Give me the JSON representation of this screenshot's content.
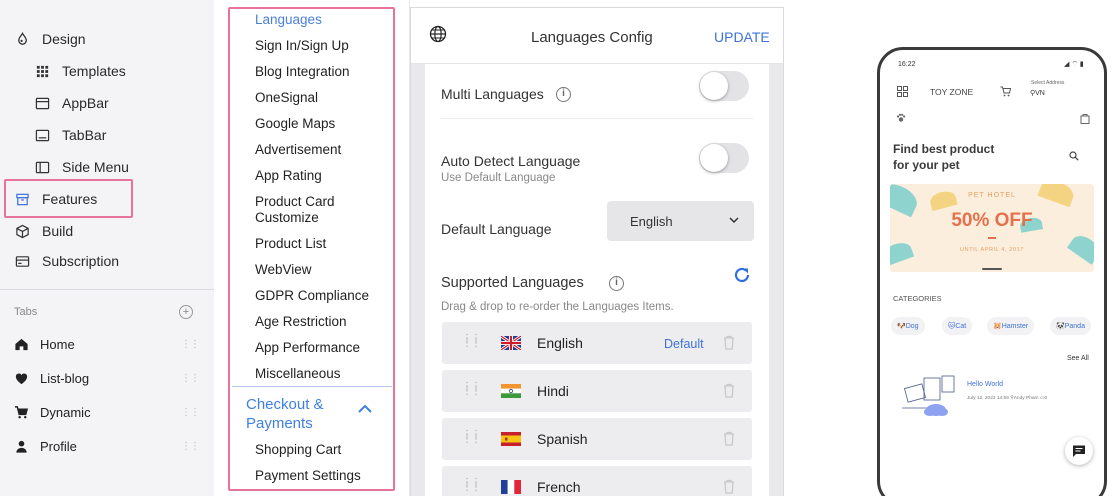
{
  "left_nav": {
    "items": [
      {
        "label": "Design",
        "icon": "palette-icon"
      },
      {
        "label": "Templates",
        "icon": "grid-icon"
      },
      {
        "label": "AppBar",
        "icon": "appbar-icon"
      },
      {
        "label": "TabBar",
        "icon": "tabbar-icon"
      },
      {
        "label": "Side Menu",
        "icon": "side-menu-icon"
      },
      {
        "label": "Features",
        "icon": "archive-icon"
      },
      {
        "label": "Build",
        "icon": "cube-icon"
      },
      {
        "label": "Subscription",
        "icon": "card-icon"
      }
    ],
    "tabs_label": "Tabs",
    "tabs": [
      {
        "label": "Home",
        "icon": "home-icon"
      },
      {
        "label": "List-blog",
        "icon": "heart-icon"
      },
      {
        "label": "Dynamic",
        "icon": "cart-icon"
      },
      {
        "label": "Profile",
        "icon": "person-icon"
      }
    ],
    "highlight_color": "#e8739a"
  },
  "feature_list": {
    "items": [
      "Languages",
      "Sign In/Sign Up",
      "Blog Integration",
      "OneSignal",
      "Google Maps",
      "Advertisement",
      "App Rating",
      "Product Card Customize",
      "Product List",
      "WebView",
      "GDPR Compliance",
      "Age Restriction",
      "App Performance",
      "Miscellaneous"
    ],
    "active": "Languages",
    "section_title": "Checkout & Payments",
    "section_items": [
      "Shopping Cart",
      "Payment Settings"
    ],
    "accent_color": "#3f7fe0"
  },
  "config": {
    "title": "Languages Config",
    "update_label": "UPDATE",
    "multi_languages_label": "Multi Languages",
    "multi_languages_enabled": false,
    "auto_detect_label": "Auto Detect Language",
    "auto_detect_sub": "Use Default Language",
    "auto_detect_enabled": false,
    "default_language_label": "Default Language",
    "default_language_value": "English",
    "supported_label": "Supported Languages",
    "supported_hint": "Drag & drop to re-order the Languages Items.",
    "languages": [
      {
        "name": "English",
        "flag": "uk-flag",
        "badge": "Default"
      },
      {
        "name": "Hindi",
        "flag": "india-flag",
        "badge": ""
      },
      {
        "name": "Spanish",
        "flag": "spain-flag",
        "badge": ""
      },
      {
        "name": "French",
        "flag": "france-flag",
        "badge": ""
      }
    ]
  },
  "phone": {
    "time": "16:22",
    "brand": "TOY ZONE",
    "address_label": "Select Address",
    "address_value": "VN",
    "headline_1": "Find best product",
    "headline_2": "for your pet",
    "banner_pre": "PET HOTEL",
    "banner_main": "50% OFF",
    "banner_sub": "UNTIL APRIL 4, 2017",
    "categories_label": "CATEGORIES",
    "categories": [
      "Dog",
      "Cat",
      "Hamster",
      "Panda"
    ],
    "see_all": "See All",
    "post_title": "Hello World",
    "post_meta": "July 12, 2022 14:59",
    "post_author": "Andy Pham",
    "post_comments": "0"
  }
}
